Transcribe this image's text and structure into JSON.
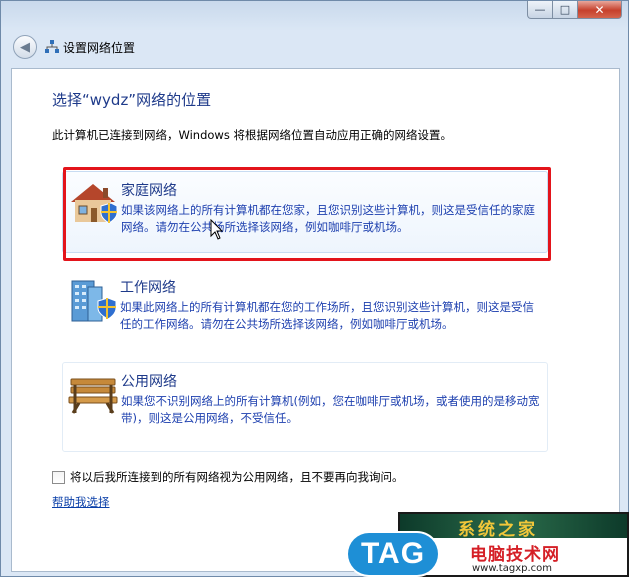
{
  "window": {
    "nav_title": "设置网络位置",
    "minimize_glyph": "—",
    "maximize_glyph": "□",
    "close_glyph": "✕"
  },
  "page": {
    "heading": "选择“wydz”网络的位置",
    "description": "此计算机已连接到网络，Windows 将根据网络位置自动应用正确的网络设置。"
  },
  "options": [
    {
      "title": "家庭网络",
      "text": "如果该网络上的所有计算机都在您家，且您识别这些计算机，则这是受信任的家庭网络。请勿在公共场所选择该网络，例如咖啡厅或机场。",
      "icon": "house-shield-icon"
    },
    {
      "title": "工作网络",
      "text": "如果此网络上的所有计算机都在您的工作场所，且您识别这些计算机，则这是受信任的工作网络。请勿在公共场所选择该网络，例如咖啡厅或机场。",
      "icon": "office-building-shield-icon"
    },
    {
      "title": "公用网络",
      "text": "如果您不识别网络上的所有计算机(例如，您在咖啡厅或机场，或者使用的是移动宽带)，则这是公用网络，不受信任。",
      "icon": "park-bench-icon"
    }
  ],
  "checkbox": {
    "label": "将以后我所连接到的所有网络视为公用网络，且不要再向我询问。",
    "checked": false
  },
  "help_link": "帮助我选择",
  "watermark": {
    "top_text": "系统之家",
    "tag": "TAG",
    "cn": "电脑技术网",
    "url": "www.tagxp.com"
  },
  "colors": {
    "highlight_border": "#e3141b",
    "link_blue": "#1e3a8a"
  }
}
